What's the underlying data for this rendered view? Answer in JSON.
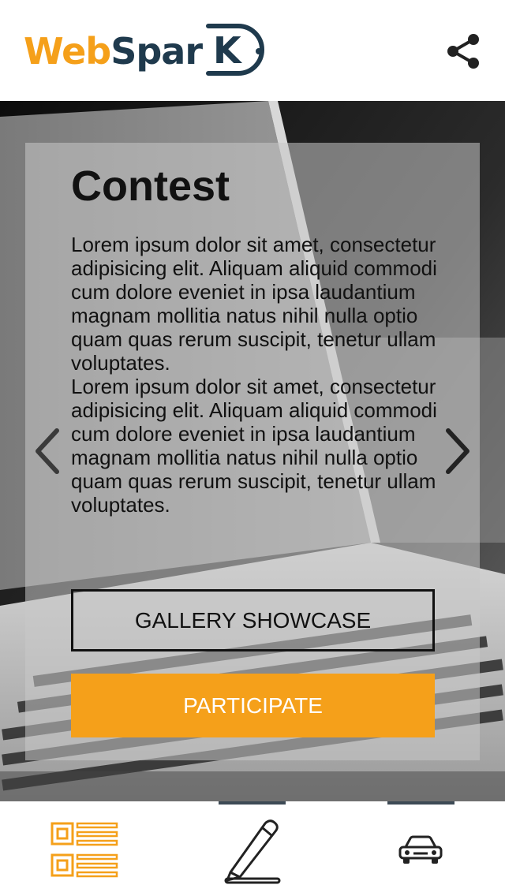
{
  "header": {
    "logo": {
      "part1": "Web",
      "part2": "Spar",
      "part3": "K"
    },
    "share_icon": "share-icon"
  },
  "content": {
    "title": "Contest",
    "paragraphs": [
      "Lorem ipsum dolor sit amet, consectetur adipisicing elit. Aliquam aliquid commodi cum dolore eveniet in ipsa laudantium magnam mollitia natus nihil nulla optio quam quas rerum suscipit, tenetur ullam voluptates.",
      "Lorem ipsum dolor sit amet, consectetur adipisicing elit. Aliquam aliquid commodi cum dolore eveniet in ipsa laudantium magnam mollitia natus nihil nulla optio quam quas rerum suscipit, tenetur ullam voluptates."
    ],
    "gallery_button": "GALLERY SHOWCASE",
    "participate_button": "PARTICIPATE",
    "prev_icon": "chevron-left-icon",
    "next_icon": "chevron-right-icon"
  },
  "tabbar": {
    "tabs": [
      {
        "icon": "list-icon",
        "active": true
      },
      {
        "icon": "pencil-icon",
        "active": false
      },
      {
        "icon": "car-icon",
        "active": false
      }
    ]
  },
  "colors": {
    "accent": "#f5a01a",
    "brand_dark": "#1f3a4d",
    "text": "#111111",
    "white": "#ffffff"
  }
}
